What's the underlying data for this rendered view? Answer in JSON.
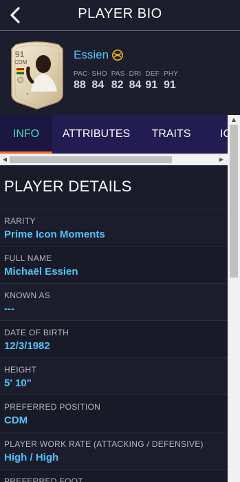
{
  "header": {
    "title": "PLAYER BIO"
  },
  "player": {
    "name": "Essien",
    "card": {
      "rating": "91",
      "position": "CDM"
    },
    "stats": [
      {
        "label": "PAC",
        "value": "88"
      },
      {
        "label": "SHO",
        "value": "84"
      },
      {
        "label": "PAS",
        "value": "82"
      },
      {
        "label": "DRI",
        "value": "84"
      },
      {
        "label": "DEF",
        "value": "91"
      },
      {
        "label": "PHY",
        "value": "91"
      }
    ]
  },
  "tabs": [
    {
      "label": "INFO",
      "active": true
    },
    {
      "label": "ATTRIBUTES",
      "active": false
    },
    {
      "label": "TRAITS",
      "active": false
    },
    {
      "label": "IC",
      "active": false
    }
  ],
  "details": {
    "title": "PLAYER DETAILS",
    "rows": [
      {
        "label": "RARITY",
        "value": "Prime Icon Moments"
      },
      {
        "label": "FULL NAME",
        "value": "Michaël Essien"
      },
      {
        "label": "KNOWN AS",
        "value": "---"
      },
      {
        "label": "DATE OF BIRTH",
        "value": "12/3/1982"
      },
      {
        "label": "HEIGHT",
        "value": "5' 10\""
      },
      {
        "label": "PREFERRED POSITION",
        "value": "CDM"
      },
      {
        "label": "PLAYER WORK RATE (ATTACKING / DEFENSIVE)",
        "value": "High / High"
      },
      {
        "label": "PREFERRED FOOT",
        "value": ""
      }
    ]
  },
  "colors": {
    "accent": "#4fc3f7",
    "tab_active": "#3be0b5",
    "tab_indicator": "#ff6a1a",
    "tab_bar": "#221c52"
  }
}
